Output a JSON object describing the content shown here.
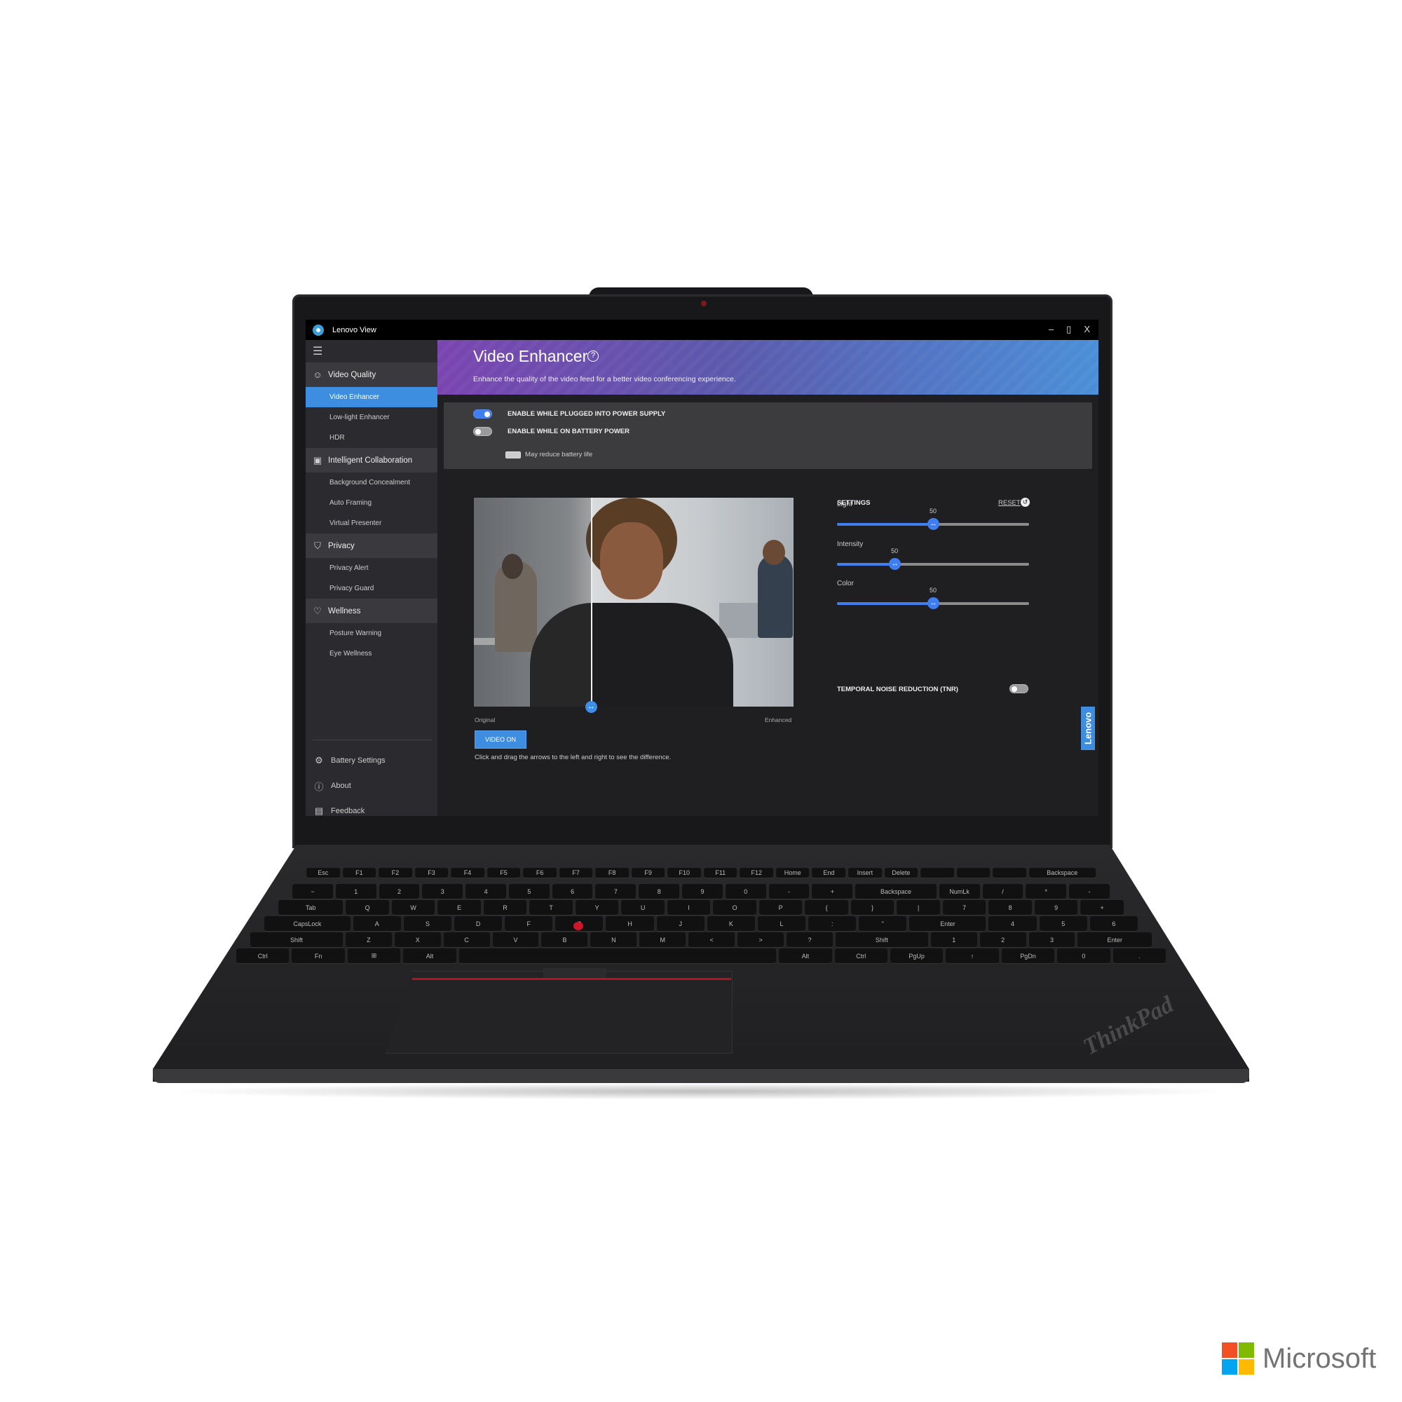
{
  "app": {
    "title": "Lenovo View",
    "window_controls": [
      "–",
      "▯",
      "X"
    ]
  },
  "sidebar": {
    "sections": [
      {
        "label": "Video Quality",
        "icon": "camera-user-icon",
        "items": [
          {
            "label": "Video Enhancer",
            "selected": true
          },
          {
            "label": "Low-light Enhancer"
          },
          {
            "label": "HDR"
          }
        ]
      },
      {
        "label": "Intelligent Collaboration",
        "icon": "presentation-icon",
        "items": [
          {
            "label": "Background Concealment"
          },
          {
            "label": "Auto Framing"
          },
          {
            "label": "Virtual Presenter"
          }
        ]
      },
      {
        "label": "Privacy",
        "icon": "shield-user-icon",
        "items": [
          {
            "label": "Privacy Alert"
          },
          {
            "label": "Privacy Guard"
          }
        ]
      },
      {
        "label": "Wellness",
        "icon": "heart-pulse-icon",
        "items": [
          {
            "label": "Posture Warning"
          },
          {
            "label": "Eye Wellness"
          }
        ]
      }
    ],
    "bottom": [
      {
        "label": "Battery Settings",
        "icon": "gear-icon"
      },
      {
        "label": "About",
        "icon": "info-icon"
      },
      {
        "label": "Feedback",
        "icon": "feedback-icon"
      }
    ]
  },
  "header": {
    "title": "Video Enhancer",
    "subtitle": "Enhance the quality of the video feed for a better video conferencing experience."
  },
  "toggles": {
    "plugged": {
      "label": "ENABLE WHILE PLUGGED INTO POWER SUPPLY",
      "on": true
    },
    "battery": {
      "label": "ENABLE WHILE ON BATTERY POWER",
      "on": false
    },
    "battery_note": "May reduce battery life"
  },
  "preview": {
    "original_label": "Original",
    "enhanced_label": "Enhanced",
    "video_button": "VIDEO ON",
    "hint": "Click and drag the arrows to the left and right to see the difference."
  },
  "settings": {
    "title": "SETTINGS",
    "reset": "RESET",
    "sliders": [
      {
        "label": "Light",
        "value": "50",
        "position_pct": 50
      },
      {
        "label": "Intensity",
        "value": "50",
        "position_pct": 30
      },
      {
        "label": "Color",
        "value": "50",
        "position_pct": 50
      }
    ],
    "tnr": {
      "label": "TEMPORAL NOISE REDUCTION (TNR)",
      "on": false
    }
  },
  "side_tab": "Lenovo",
  "keyboard": {
    "rows": [
      [
        "Esc",
        "F1",
        "F2",
        "F3",
        "F4",
        "F5",
        "F6",
        "F7",
        "F8",
        "F9",
        "F10",
        "F11",
        "F12",
        "Home",
        "End",
        "Insert",
        "Delete",
        "",
        "",
        "",
        "Backspace"
      ],
      [
        "~",
        "1",
        "2",
        "3",
        "4",
        "5",
        "6",
        "7",
        "8",
        "9",
        "0",
        "-",
        "+",
        "Backspace",
        "NumLk",
        "/",
        "*",
        "-"
      ],
      [
        "Tab",
        "Q",
        "W",
        "E",
        "R",
        "T",
        "Y",
        "U",
        "I",
        "O",
        "P",
        "{",
        "}",
        "|",
        "7",
        "8",
        "9",
        "+"
      ],
      [
        "CapsLock",
        "A",
        "S",
        "D",
        "F",
        "G",
        "H",
        "J",
        "K",
        "L",
        ":",
        "\"",
        "Enter",
        "4",
        "5",
        "6"
      ],
      [
        "Shift",
        "Z",
        "X",
        "C",
        "V",
        "B",
        "N",
        "M",
        "<",
        ">",
        "?",
        "Shift",
        "1",
        "2",
        "3",
        "Enter"
      ],
      [
        "Ctrl",
        "Fn",
        "⊞",
        "Alt",
        "",
        "Alt",
        "Ctrl",
        "PgUp",
        "↑",
        "PgDn",
        "0",
        "."
      ]
    ]
  },
  "branding": {
    "palmrest": "ThinkPad",
    "footer_logo": "Microsoft",
    "ms_colors": [
      "#f25022",
      "#7fba00",
      "#00a4ef",
      "#ffb900"
    ]
  },
  "colors": {
    "accent": "#3d8de0",
    "toggle_on": "#3e7ef0",
    "banner_start": "#7a45b0",
    "banner_end": "#4b8fd8"
  }
}
